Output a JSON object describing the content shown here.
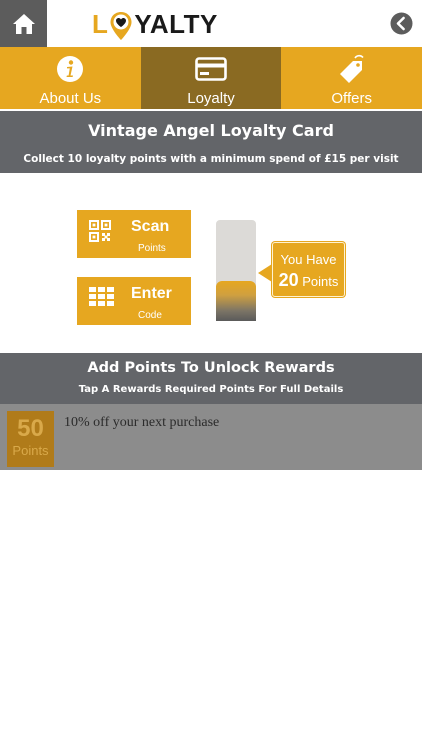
{
  "header": {
    "logo_text_1": "L",
    "logo_text_2": "YALTY",
    "home_icon": "home-icon",
    "back_icon": "chevron-left-circle-icon"
  },
  "tabs": [
    {
      "label": "About Us",
      "icon": "info-icon",
      "active": false
    },
    {
      "label": "Loyalty",
      "icon": "credit-card-icon",
      "active": true
    },
    {
      "label": "Offers",
      "icon": "tag-icon",
      "active": false
    }
  ],
  "card": {
    "title": "Vintage Angel Loyalty Card",
    "subtitle": "Collect 10 loyalty points with a minimum spend of £15 per visit"
  },
  "actions": {
    "scan": {
      "title": "Scan",
      "sub": "Points",
      "icon": "qr-code-icon"
    },
    "enter": {
      "title": "Enter",
      "sub": "Code",
      "icon": "keypad-icon"
    }
  },
  "points": {
    "label": "You Have",
    "value": "20",
    "unit": "Points",
    "meter_fraction": 0.4
  },
  "rewards": {
    "title": "Add Points To Unlock Rewards",
    "subtitle": "Tap A Rewards Required Points For Full Details",
    "items": [
      {
        "points": "50",
        "unit": "Points",
        "description": "10% off your next purchase"
      }
    ]
  },
  "colors": {
    "accent": "#e6a720",
    "accent_dark": "#8a6a22",
    "band": "#636569"
  }
}
